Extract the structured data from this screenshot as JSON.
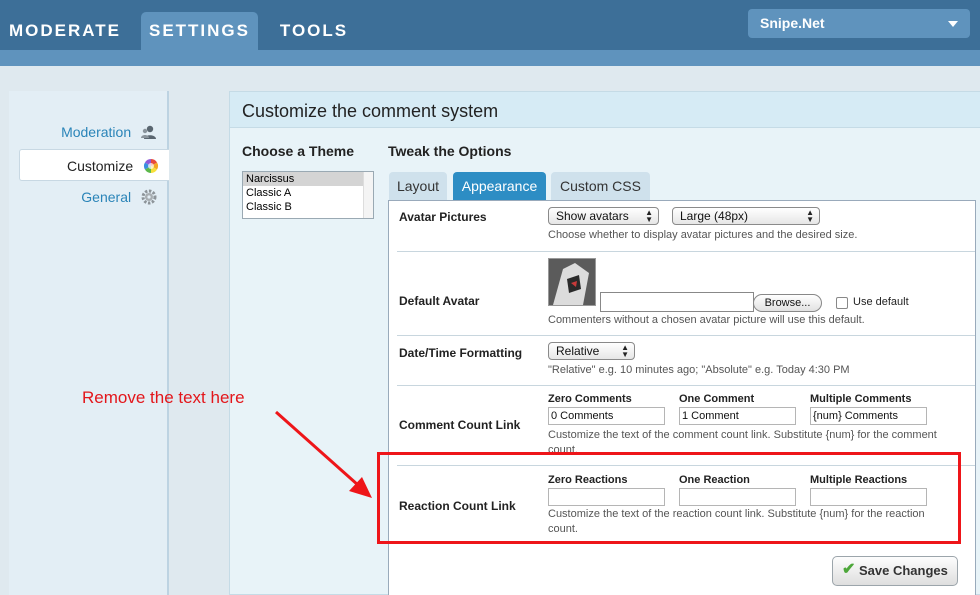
{
  "nav": {
    "tabs": [
      {
        "label": "MODERATE"
      },
      {
        "label": "SETTINGS"
      },
      {
        "label": "TOOLS"
      }
    ],
    "site_select": "Snipe.Net"
  },
  "sidebar": {
    "items": [
      {
        "label": "Moderation",
        "icon": "user-icon"
      },
      {
        "label": "Customize",
        "icon": "color-wheel-icon"
      },
      {
        "label": "General",
        "icon": "gear-icon"
      }
    ]
  },
  "main": {
    "title": "Customize the comment system",
    "theme_heading": "Choose a Theme",
    "themes": [
      "Narcissus",
      "Classic A",
      "Classic B"
    ],
    "options_heading": "Tweak the Options",
    "tabs": [
      {
        "label": "Layout"
      },
      {
        "label": "Appearance"
      },
      {
        "label": "Custom CSS"
      }
    ]
  },
  "options": {
    "avatar_pictures": {
      "label": "Avatar Pictures",
      "show_value": "Show avatars",
      "size_value": "Large (48px)",
      "help": "Choose whether to display avatar pictures and the desired size."
    },
    "default_avatar": {
      "label": "Default Avatar",
      "browse_label": "Browse...",
      "use_default_label": "Use default",
      "help": "Commenters without a chosen avatar picture will use this default."
    },
    "datetime": {
      "label": "Date/Time Formatting",
      "value": "Relative",
      "help": "\"Relative\" e.g. 10 minutes ago; \"Absolute\" e.g. Today 4:30 PM"
    },
    "comment_count": {
      "label": "Comment Count Link",
      "col_zero": "Zero Comments",
      "col_one": "One Comment",
      "col_multi": "Multiple Comments",
      "val_zero": "0 Comments",
      "val_one": "1 Comment",
      "val_multi": "{num} Comments",
      "help": "Customize the text of the comment count link. Substitute {num} for the comment count."
    },
    "reaction_count": {
      "label": "Reaction Count Link",
      "col_zero": "Zero Reactions",
      "col_one": "One Reaction",
      "col_multi": "Multiple Reactions",
      "val_zero": "",
      "val_one": "",
      "val_multi": "",
      "help": "Customize the text of the reaction count link. Substitute {num} for the reaction count."
    },
    "save_label": "Save Changes"
  },
  "annotation": {
    "text": "Remove the text here",
    "color": "#e3161b"
  }
}
